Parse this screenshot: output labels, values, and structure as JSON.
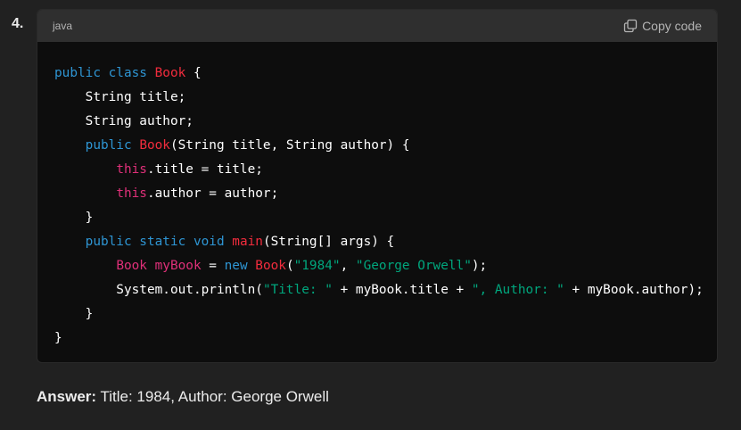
{
  "list_number": "4.",
  "code_block": {
    "language": "java",
    "copy_label": "Copy code",
    "colors": {
      "background": "#0d0d0d",
      "header": "#2f2f2f",
      "keyword": "#2e95d3",
      "class_name": "#f22c3d",
      "this_keyword": "#df3079",
      "string": "#00a67d"
    },
    "lines": [
      [
        {
          "t": "keyword",
          "v": "public class "
        },
        {
          "t": "class",
          "v": "Book"
        },
        {
          "t": "plain",
          "v": " {"
        }
      ],
      [
        {
          "t": "plain",
          "v": "    String title;"
        }
      ],
      [
        {
          "t": "plain",
          "v": "    String author;"
        }
      ],
      [
        {
          "t": "plain",
          "v": "    "
        },
        {
          "t": "keyword",
          "v": "public "
        },
        {
          "t": "class",
          "v": "Book"
        },
        {
          "t": "plain",
          "v": "(String title, String author) {"
        }
      ],
      [
        {
          "t": "plain",
          "v": "        "
        },
        {
          "t": "this",
          "v": "this"
        },
        {
          "t": "plain",
          "v": ".title = title;"
        }
      ],
      [
        {
          "t": "plain",
          "v": "        "
        },
        {
          "t": "this",
          "v": "this"
        },
        {
          "t": "plain",
          "v": ".author = author;"
        }
      ],
      [
        {
          "t": "plain",
          "v": "    }"
        }
      ],
      [
        {
          "t": "plain",
          "v": "    "
        },
        {
          "t": "keyword",
          "v": "public static void "
        },
        {
          "t": "class",
          "v": "main"
        },
        {
          "t": "plain",
          "v": "(String[] args) {"
        }
      ],
      [
        {
          "t": "plain",
          "v": "        "
        },
        {
          "t": "this",
          "v": "Book myBook"
        },
        {
          "t": "plain",
          "v": " = "
        },
        {
          "t": "keyword",
          "v": "new "
        },
        {
          "t": "class",
          "v": "Book"
        },
        {
          "t": "plain",
          "v": "("
        },
        {
          "t": "string",
          "v": "\"1984\""
        },
        {
          "t": "plain",
          "v": ", "
        },
        {
          "t": "string",
          "v": "\"George Orwell\""
        },
        {
          "t": "plain",
          "v": ");"
        }
      ],
      [
        {
          "t": "plain",
          "v": "        System.out.println("
        },
        {
          "t": "string",
          "v": "\"Title: \""
        },
        {
          "t": "plain",
          "v": " + myBook.title + "
        },
        {
          "t": "string",
          "v": "\", Author: \""
        },
        {
          "t": "plain",
          "v": " + myBook.author);"
        }
      ],
      [
        {
          "t": "plain",
          "v": "    }"
        }
      ],
      [
        {
          "t": "plain",
          "v": "}"
        }
      ]
    ]
  },
  "answer": {
    "label": "Answer:",
    "text": " Title: 1984, Author: George Orwell"
  }
}
